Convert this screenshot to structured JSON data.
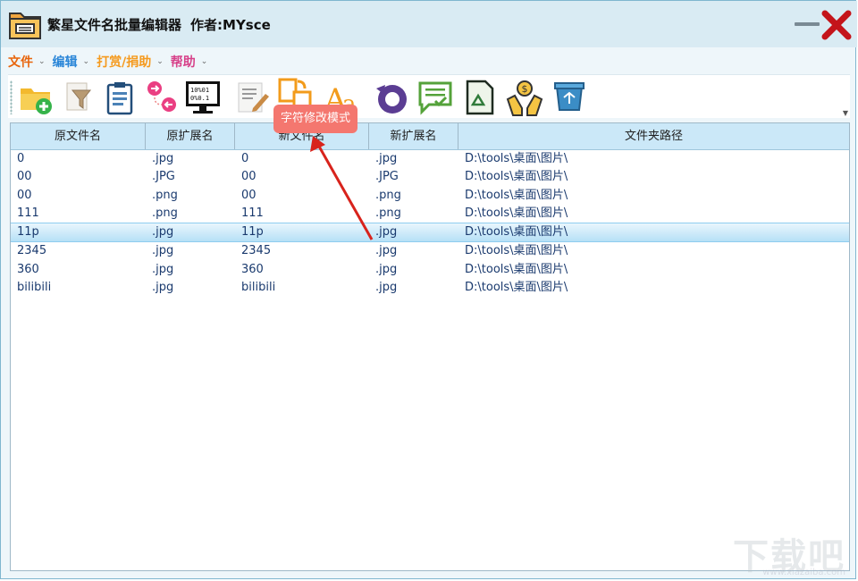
{
  "window": {
    "title": "繁星文件名批量编辑器",
    "author": "作者:MYsce"
  },
  "menu": [
    {
      "label": "文件",
      "color": "#e8650c"
    },
    {
      "label": "编辑",
      "color": "#2a86d8"
    },
    {
      "label": "打赏/捐助",
      "color": "#f59a1e"
    },
    {
      "label": "帮助",
      "color": "#d7428a"
    }
  ],
  "toolbar": {
    "buttons": [
      {
        "icon": "add-folder-icon"
      },
      {
        "icon": "filter-icon"
      },
      {
        "icon": "clipboard-icon"
      },
      {
        "icon": "swap-icon"
      },
      {
        "icon": "binary-monitor-icon"
      },
      {
        "icon": "edit-document-icon"
      },
      {
        "icon": "character-replace-icon"
      },
      {
        "icon": "font-case-icon"
      },
      {
        "icon": "undo-icon"
      },
      {
        "icon": "checklist-icon"
      },
      {
        "icon": "recycle-document-icon"
      },
      {
        "icon": "donate-icon"
      },
      {
        "icon": "recycle-bin-icon"
      }
    ],
    "tooltip": "字符修改模式"
  },
  "table": {
    "headers": [
      "原文件名",
      "原扩展名",
      "新文件名",
      "新扩展名",
      "文件夹路径"
    ],
    "rows": [
      [
        "0",
        ".jpg",
        "0",
        ".jpg",
        "D:\\tools\\桌面\\图片\\"
      ],
      [
        "00",
        ".JPG",
        "00",
        ".JPG",
        "D:\\tools\\桌面\\图片\\"
      ],
      [
        "00",
        ".png",
        "00",
        ".png",
        "D:\\tools\\桌面\\图片\\"
      ],
      [
        "111",
        ".png",
        "111",
        ".png",
        "D:\\tools\\桌面\\图片\\"
      ],
      [
        "11p",
        ".jpg",
        "11p",
        ".jpg",
        "D:\\tools\\桌面\\图片\\"
      ],
      [
        "2345",
        ".jpg",
        "2345",
        ".jpg",
        "D:\\tools\\桌面\\图片\\"
      ],
      [
        "360",
        ".jpg",
        "360",
        ".jpg",
        "D:\\tools\\桌面\\图片\\"
      ],
      [
        "bilibili",
        ".jpg",
        "bilibili",
        ".jpg",
        "D:\\tools\\桌面\\图片\\"
      ]
    ],
    "selected_row": 4
  },
  "watermark": {
    "text": "下载吧",
    "url": "www.xiazaiba.com"
  },
  "colors": {
    "accent": "#cbe8f8",
    "tooltip": "#f4776f",
    "arrow": "#d8231c"
  }
}
